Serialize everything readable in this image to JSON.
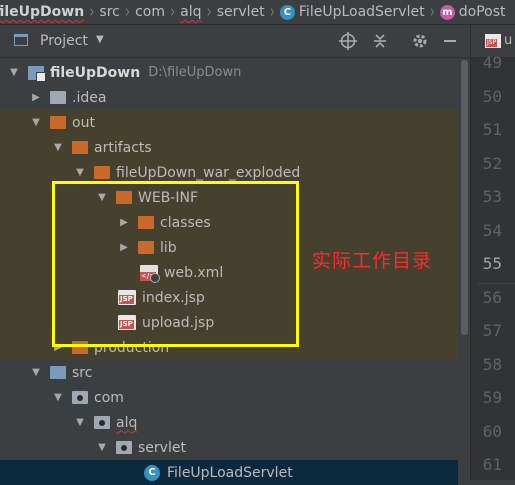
{
  "breadcrumb": {
    "items": [
      "fileUpDown",
      "src",
      "com",
      "alq",
      "servlet",
      "FileUpLoadServlet",
      "doPost"
    ],
    "class_badge": "C",
    "method_badge": "m"
  },
  "panel": {
    "title": "Project",
    "dropdown_glyph": "▼"
  },
  "tree": {
    "root": {
      "name": "fileUpDown",
      "path": "D:\\fileUpDown"
    },
    "idea": ".idea",
    "out": "out",
    "artifacts": "artifacts",
    "war_exploded": "fileUpDown_war_exploded",
    "web_inf": "WEB-INF",
    "classes": "classes",
    "lib": "lib",
    "web_xml": "web.xml",
    "index_jsp": "index.jsp",
    "upload_jsp": "upload.jsp",
    "production": "production",
    "src": "src",
    "com": "com",
    "alq": "alq",
    "servlet": "servlet",
    "servlet_class": "FileUpLoadServlet",
    "jsp_badge": "JSP",
    "xml_badge": "</>"
  },
  "annotation": {
    "text": "实际工作目录",
    "color": "#ff2a2a",
    "box_color": "#ffff00"
  },
  "editor": {
    "tab_label": "u",
    "line_numbers": [
      "49",
      "50",
      "51",
      "52",
      "53",
      "54",
      "55",
      "56",
      "57",
      "58",
      "59",
      "60",
      "61"
    ],
    "current_line": "55"
  },
  "colors": {
    "excluded_bg": "#45412e",
    "selected_bg": "#0d293e",
    "folder_orange": "#c96a2c",
    "folder_blue": "#7a9bb9"
  }
}
